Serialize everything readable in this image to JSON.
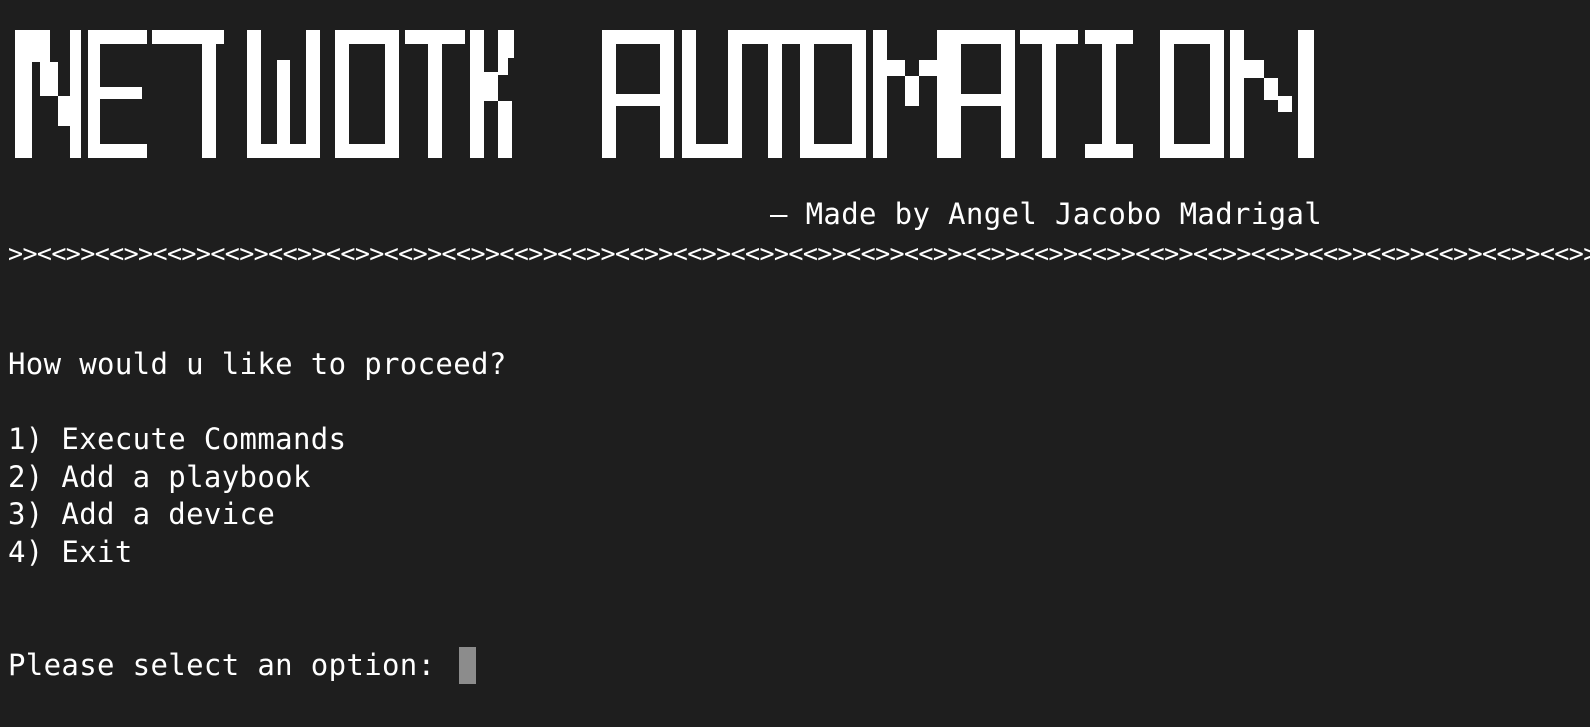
{
  "terminal": {
    "banner_text": "NETWOTK AUTOMATION",
    "credit": "— Made by Angel Jacobo Madrigal",
    "divider": ">><<>><<>><<>><<>><<>><<>><<>><<>><<>><<>><<>><<>><<>><<>><<>><<>><<>><<>><<>><<>><<>><<>><<>><<>><<>><<>><<>><<>><<>><<>><<>><<>><<>><<>><<>><<>><<>><<>><<>><<",
    "question": "How would u like to proceed?",
    "menu": [
      {
        "label": "1) Execute Commands"
      },
      {
        "label": "2) Add a playbook"
      },
      {
        "label": "3) Add a device"
      },
      {
        "label": "4) Exit"
      }
    ],
    "prompt": "Please select an option: ",
    "colors": {
      "background": "#1e1e1e",
      "text": "#ffffff",
      "cursor": "#8c8c8c"
    }
  }
}
